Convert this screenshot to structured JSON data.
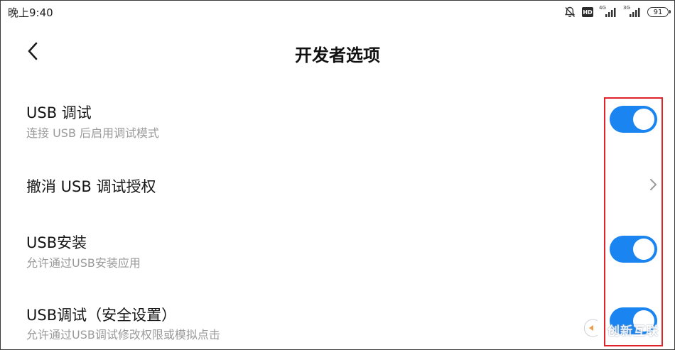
{
  "status_bar": {
    "time": "晚上9:40",
    "icons": [
      "mute-bell-icon",
      "hd-icon",
      "signal-4g-icon",
      "signal-3g-icon",
      "battery-icon"
    ],
    "hd_label": "HD",
    "network_1": "4G",
    "network_2": "3G",
    "battery_level": "91"
  },
  "header": {
    "title": "开发者选项",
    "back_icon": "chevron-left-icon"
  },
  "settings": {
    "usb_debugging": {
      "title": "USB 调试",
      "subtitle": "连接 USB 后启用调试模式",
      "enabled": true
    },
    "revoke_auth": {
      "title": "撤消 USB 调试授权",
      "icon": "chevron-right-icon"
    },
    "usb_install": {
      "title": "USB安装",
      "subtitle": "允许通过USB安装应用",
      "enabled": true
    },
    "usb_debug_security": {
      "title": "USB调试（安全设置）",
      "subtitle": "允许通过USB调试修改权限或模拟点击",
      "enabled": true
    }
  },
  "colors": {
    "toggle_on": "#1a84f0",
    "highlight": "#e0222a",
    "subtitle": "#9a9a9a"
  },
  "watermark": {
    "text": "创新互联"
  }
}
